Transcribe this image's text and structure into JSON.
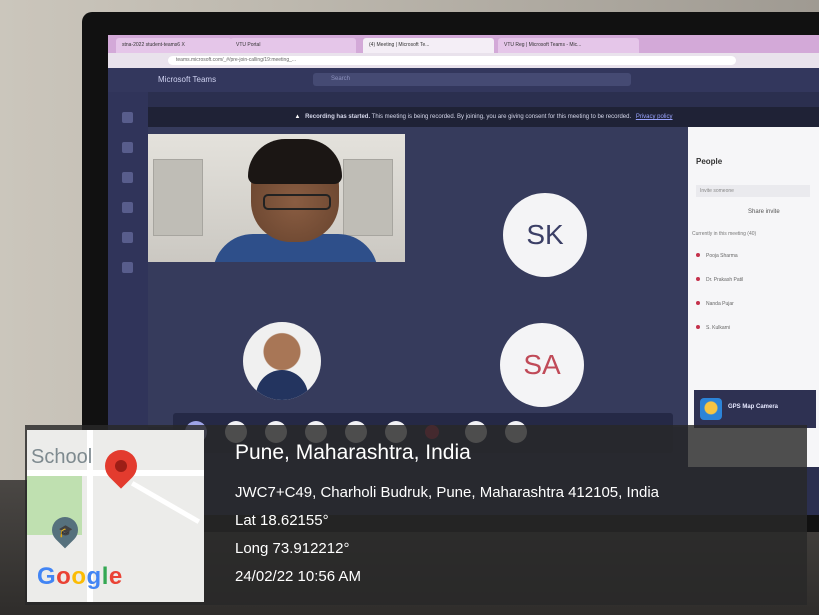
{
  "browser": {
    "tabs": [
      {
        "label": "stna-2022 student-teams6 X"
      },
      {
        "label": "VTU Portal"
      },
      {
        "label": "(4) Meeting | Microsoft Te..."
      },
      {
        "label": "VTU Reg | Microsoft Teams - Mic..."
      }
    ],
    "url": "teams.microsoft.com/_#/pre-join-calling/19:meeting_..."
  },
  "teams": {
    "app_title": "Microsoft Teams",
    "search_placeholder": "Search",
    "banner": {
      "bold": "Recording has started.",
      "text": "This meeting is being recorded. By joining, you are giving consent for this meeting to be recorded.",
      "link": "Privacy policy"
    },
    "participants": {
      "sk_initials": "SK",
      "sa_initials": "SA"
    },
    "people_panel": {
      "title": "People",
      "invite_placeholder": "Invite someone",
      "share": "Share invite",
      "section": "Currently in this meeting (40)",
      "members": [
        "Pooja Sharma",
        "Dr. Prakash Patil",
        "Nanda Pujar",
        "S. Kulkarni"
      ]
    },
    "gps_app_label": "GPS Map Camera"
  },
  "gps_overlay": {
    "map_label": "School",
    "logo_text": "Google",
    "title": "Pune, Maharashtra, India",
    "address": "JWC7+C49, Charholi Budruk, Pune, Maharashtra 412105, India",
    "lat": "Lat 18.62155°",
    "long": "Long 73.912212°",
    "datetime": "24/02/22 10:56 AM",
    "colors": {
      "pin": "#e33b2e"
    }
  }
}
